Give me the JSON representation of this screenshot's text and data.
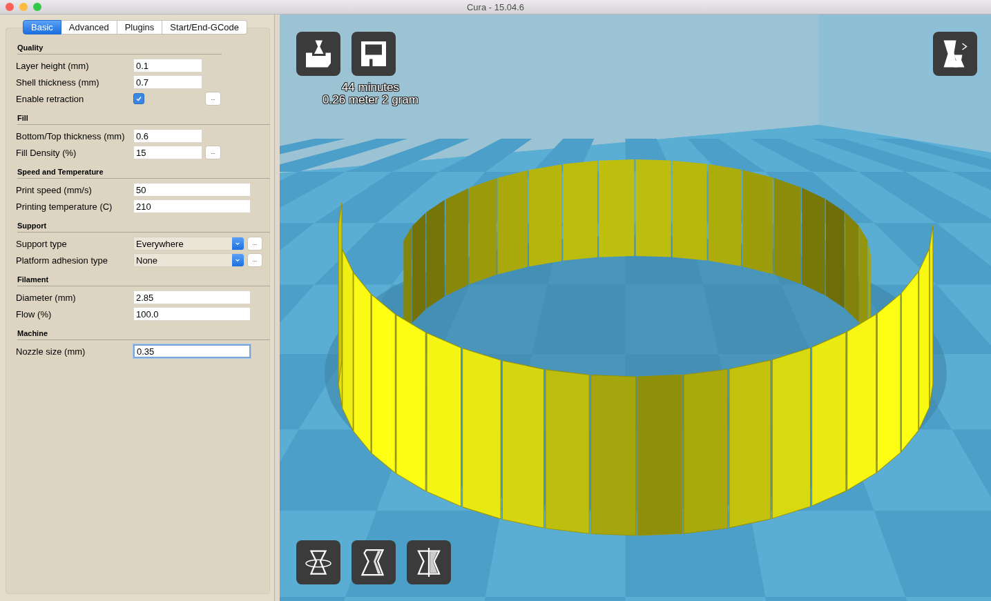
{
  "window": {
    "title": "Cura - 15.04.6"
  },
  "tabs": [
    {
      "label": "Basic",
      "selected": true
    },
    {
      "label": "Advanced",
      "selected": false
    },
    {
      "label": "Plugins",
      "selected": false
    },
    {
      "label": "Start/End-GCode",
      "selected": false
    }
  ],
  "sections": [
    {
      "title": "Quality",
      "rows": [
        {
          "kind": "text",
          "label": "Layer height (mm)",
          "value": "0.1",
          "more": false,
          "focused": false
        },
        {
          "kind": "text",
          "label": "Shell thickness (mm)",
          "value": "0.7",
          "more": false,
          "focused": false
        },
        {
          "kind": "checkbox",
          "label": "Enable retraction",
          "checked": true,
          "more": true,
          "more_label": "..."
        }
      ]
    },
    {
      "title": "Fill",
      "rows": [
        {
          "kind": "text",
          "label": "Bottom/Top thickness (mm)",
          "value": "0.6",
          "more": false,
          "focused": false
        },
        {
          "kind": "text",
          "label": "Fill Density (%)",
          "value": "15",
          "more": true,
          "more_label": "...",
          "focused": false
        }
      ]
    },
    {
      "title": "Speed and Temperature",
      "rows": [
        {
          "kind": "text",
          "label": "Print speed (mm/s)",
          "value": "50",
          "more": false,
          "focused": false
        },
        {
          "kind": "text",
          "label": "Printing temperature (C)",
          "value": "210",
          "more": false,
          "focused": false
        }
      ]
    },
    {
      "title": "Support",
      "rows": [
        {
          "kind": "select",
          "label": "Support type",
          "value": "Everywhere",
          "more": true,
          "more_label": "..."
        },
        {
          "kind": "select",
          "label": "Platform adhesion type",
          "value": "None",
          "more": true,
          "more_label": "..."
        }
      ]
    },
    {
      "title": "Filament",
      "rows": [
        {
          "kind": "text",
          "label": "Diameter (mm)",
          "value": "2.85",
          "more": false,
          "focused": false
        },
        {
          "kind": "text",
          "label": "Flow (%)",
          "value": "100.0",
          "more": false,
          "focused": false
        }
      ]
    },
    {
      "title": "Machine",
      "rows": [
        {
          "kind": "text",
          "label": "Nozzle size (mm)",
          "value": "0.35",
          "more": false,
          "focused": true
        }
      ]
    }
  ],
  "viewport": {
    "print_time": "44 minutes",
    "print_material": "0.26 meter 2 gram"
  }
}
